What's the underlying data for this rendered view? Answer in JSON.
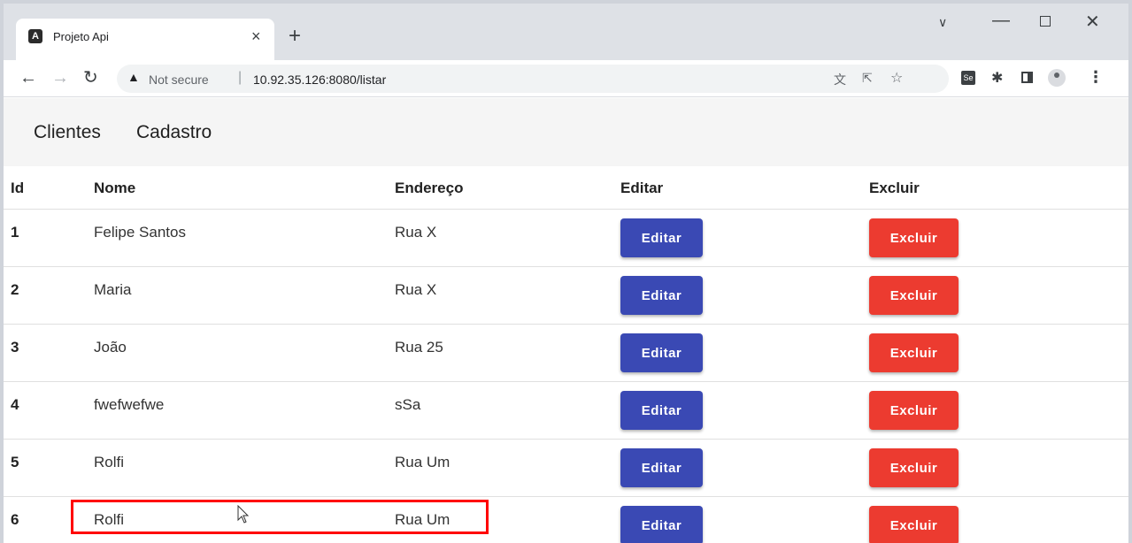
{
  "browser": {
    "tab_title": "Projeto Api",
    "favicon_letter": "A",
    "tab_close": "×",
    "new_tab": "+",
    "security_label": "Not secure",
    "url": "10.92.35.126:8080/listar"
  },
  "app_nav": {
    "items": [
      {
        "label": "Clientes"
      },
      {
        "label": "Cadastro"
      }
    ]
  },
  "table": {
    "columns": [
      "Id",
      "Nome",
      "Endereço",
      "Editar",
      "Excluir"
    ],
    "edit_label": "Editar",
    "delete_label": "Excluir",
    "rows": [
      {
        "id": "1",
        "nome": "Felipe Santos",
        "endereco": "Rua X"
      },
      {
        "id": "2",
        "nome": "Maria",
        "endereco": "Rua X"
      },
      {
        "id": "3",
        "nome": "João",
        "endereco": "Rua 25"
      },
      {
        "id": "4",
        "nome": "fwefwefwe",
        "endereco": "sSa"
      },
      {
        "id": "5",
        "nome": "Rolfi",
        "endereco": "Rua Um"
      },
      {
        "id": "6",
        "nome": "Rolfi",
        "endereco": "Rua Um"
      }
    ]
  },
  "colors": {
    "edit_button": "#3a49b4",
    "delete_button": "#ec3b30",
    "highlight_box": "#ff0000"
  }
}
